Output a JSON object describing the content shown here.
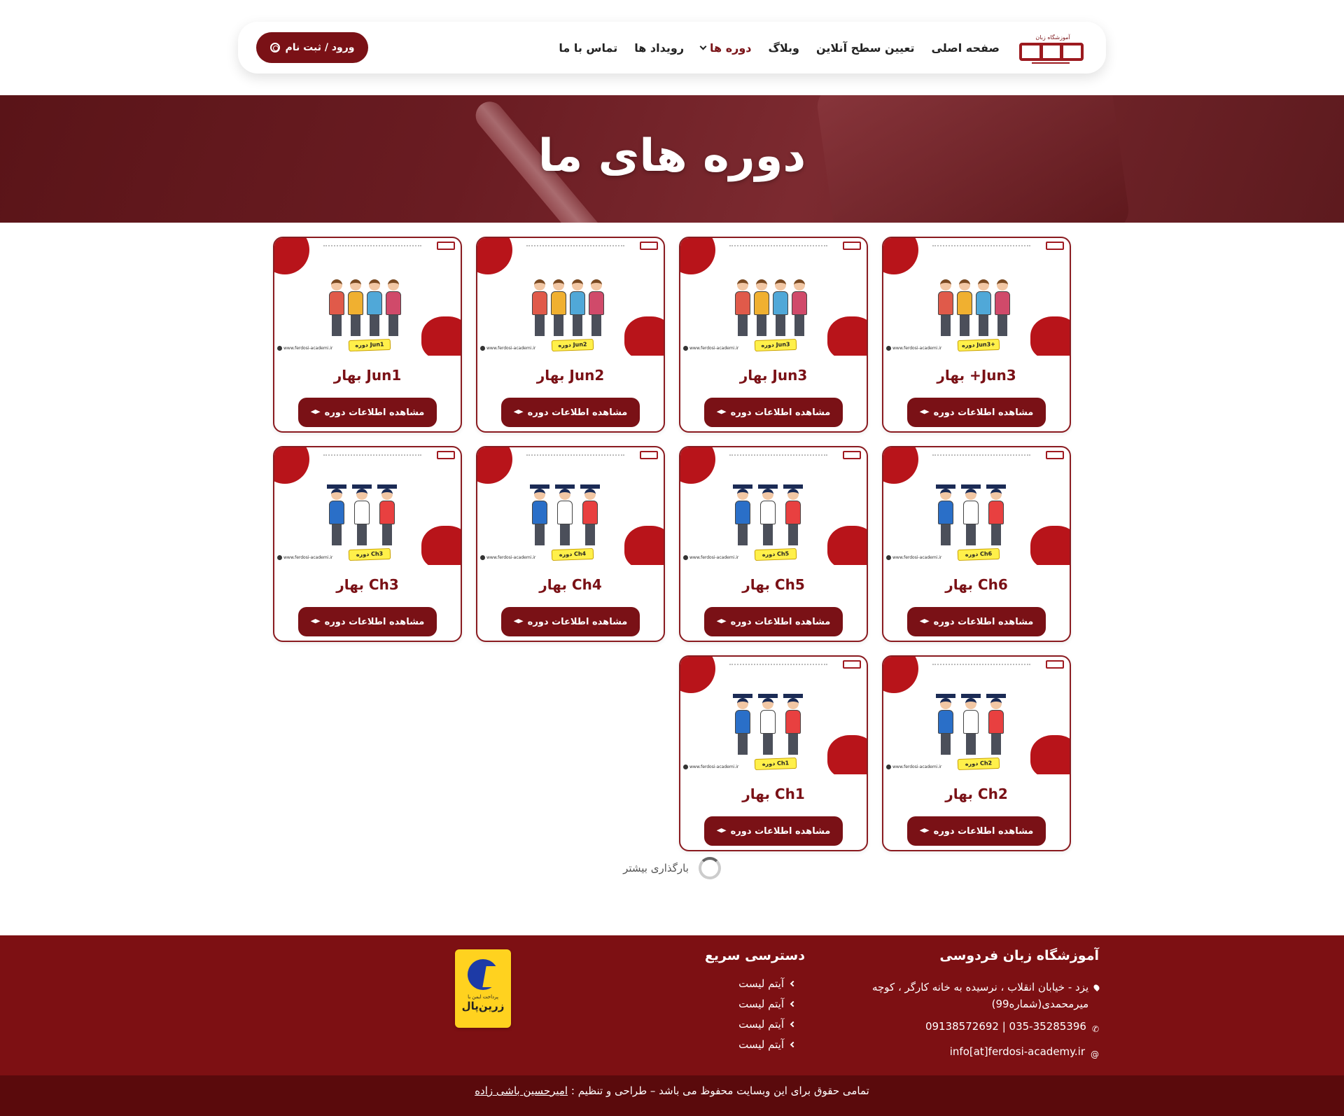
{
  "header": {
    "logo_text": "آموزشگاه زبان",
    "nav": [
      {
        "label": "صفحه اصلی",
        "active": false
      },
      {
        "label": "تعیین سطح آنلاین",
        "active": false
      },
      {
        "label": "وبلاگ",
        "active": false
      },
      {
        "label": "دوره ها",
        "active": true
      },
      {
        "label": "رویداد ها",
        "active": false
      },
      {
        "label": "تماس با ما",
        "active": false
      }
    ],
    "login_label": "ورود / ثبت نام"
  },
  "hero": {
    "title": "دوره های ما"
  },
  "course_button_label": "مشاهده اطلاعات دوره",
  "courses": [
    {
      "title": "Jun3+ بهار",
      "tag": "دوره Jun3+",
      "image": "kids-backpack"
    },
    {
      "title": "Jun3 بهار",
      "tag": "دوره Jun3",
      "image": "kids-backpack"
    },
    {
      "title": "Jun2 بهار",
      "tag": "دوره Jun2",
      "image": "kids-backpack"
    },
    {
      "title": "Jun1 بهار",
      "tag": "دوره Jun1",
      "image": "kids-backpack"
    },
    {
      "title": "Ch6 بهار",
      "tag": "دوره Ch6",
      "image": "kids-graduates"
    },
    {
      "title": "Ch5 بهار",
      "tag": "دوره Ch5",
      "image": "kids-graduates"
    },
    {
      "title": "Ch4 بهار",
      "tag": "دوره Ch4",
      "image": "kids-graduates"
    },
    {
      "title": "Ch3 بهار",
      "tag": "دوره Ch3",
      "image": "kids-graduates"
    },
    {
      "title": "Ch2 بهار",
      "tag": "دوره Ch2",
      "image": "kids-graduates"
    },
    {
      "title": "Ch1 بهار",
      "tag": "دوره Ch1",
      "image": "kids-graduates"
    }
  ],
  "card_site_text": "www.ferdosi-academi.ir",
  "load_more": "بارگذاری بیشتر",
  "footer": {
    "about_title": "آموزشگاه زبان فردوسی",
    "address": "یزد - خیابان انقلاب ، نرسیده به خانه کارگر ، کوچه میرمحمدی(شماره99)",
    "phones": "035-35285396 | 09138572692",
    "email": "info[at]ferdosi-academy.ir",
    "quick_title": "دسترسی سریع",
    "quick_links": [
      "آیتم لیست",
      "آیتم لیست",
      "آیتم لیست",
      "آیتم لیست"
    ],
    "badge_line1": "پرداخت ایمن با",
    "badge_line2": "زرین‌پال",
    "copyright_text": "تمامی حقوق برای این وبسایت محفوظ می باشد – طراحی و تنظیم :",
    "designer": "امیرحسین باشی زاده"
  },
  "colors": {
    "brand": "#7a1116",
    "accent": "#b8141a",
    "footer": "#7d1013",
    "footer_bottom": "#5a0a0c"
  }
}
